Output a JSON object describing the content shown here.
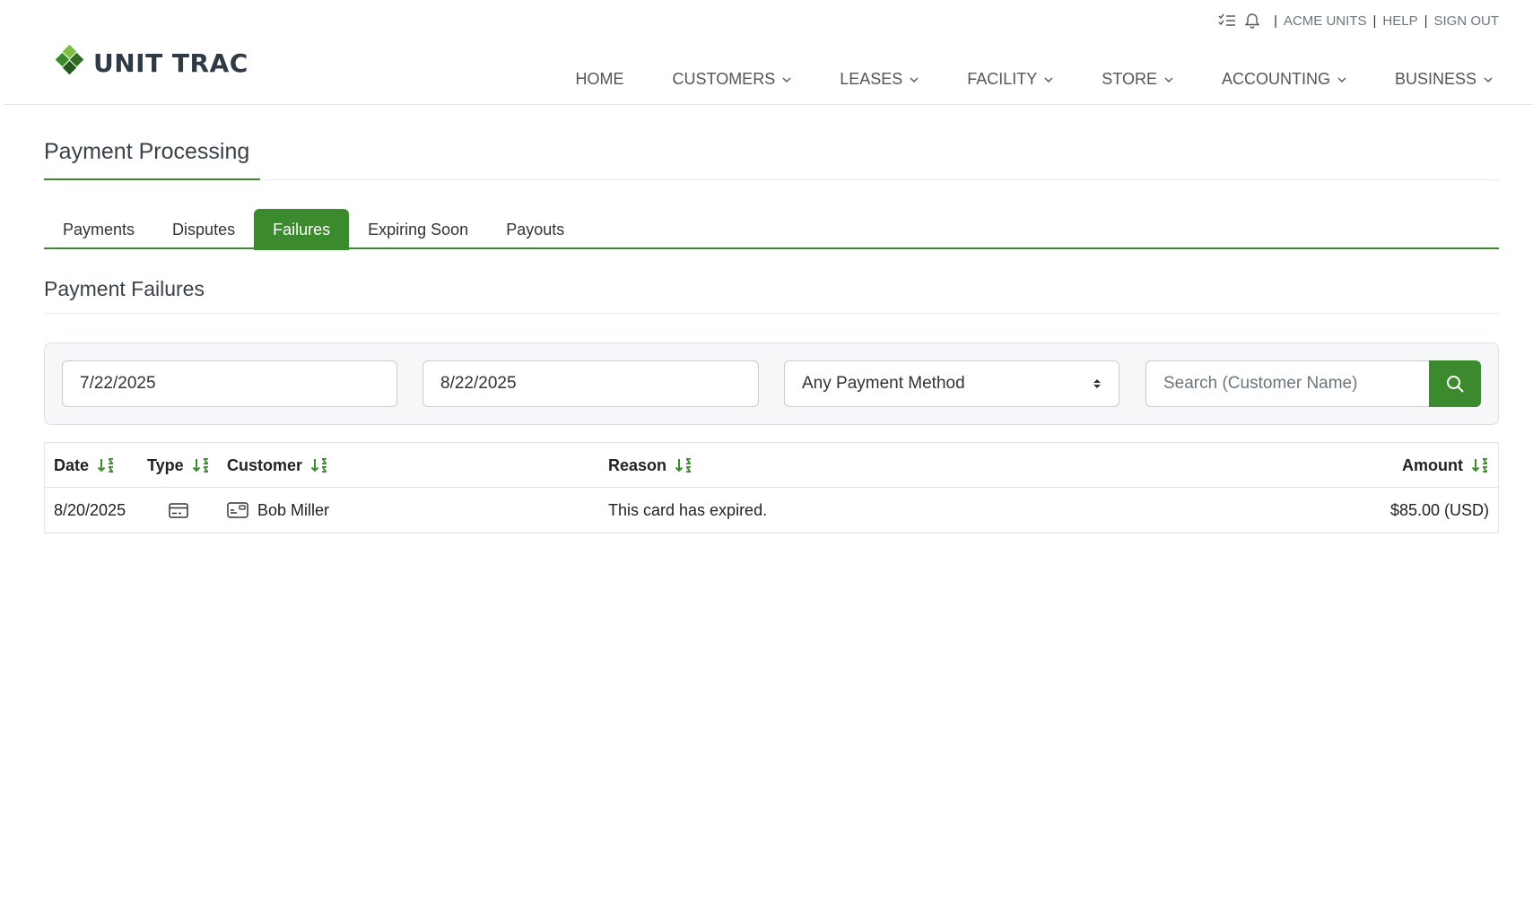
{
  "utility": {
    "tasks_icon": "tasks-list-icon",
    "bell_icon": "bell-icon",
    "company": "ACME UNITS",
    "help": "HELP",
    "signout": "SIGN OUT"
  },
  "brand": {
    "name": "UNIT TRAC",
    "accent": "#3c8a2e"
  },
  "nav": [
    {
      "label": "HOME",
      "dropdown": false
    },
    {
      "label": "CUSTOMERS",
      "dropdown": true
    },
    {
      "label": "LEASES",
      "dropdown": true
    },
    {
      "label": "FACILITY",
      "dropdown": true
    },
    {
      "label": "STORE",
      "dropdown": true
    },
    {
      "label": "ACCOUNTING",
      "dropdown": true
    },
    {
      "label": "BUSINESS",
      "dropdown": true
    }
  ],
  "page": {
    "title": "Payment Processing"
  },
  "tabs": [
    {
      "label": "Payments",
      "active": false
    },
    {
      "label": "Disputes",
      "active": false
    },
    {
      "label": "Failures",
      "active": true
    },
    {
      "label": "Expiring Soon",
      "active": false
    },
    {
      "label": "Payouts",
      "active": false
    }
  ],
  "section": {
    "title": "Payment Failures"
  },
  "filters": {
    "start_date": "7/22/2025",
    "end_date": "8/22/2025",
    "payment_method": "Any Payment Method",
    "search_placeholder": "Search (Customer Name)"
  },
  "table": {
    "columns": [
      "Date",
      "Type",
      "Customer",
      "Reason",
      "Amount"
    ],
    "rows": [
      {
        "date": "8/20/2025",
        "type_icon": "credit-card-icon",
        "customer_icon": "customer-card-icon",
        "customer": "Bob Miller",
        "reason": "This card has expired.",
        "amount": "$85.00 (USD)"
      }
    ]
  }
}
